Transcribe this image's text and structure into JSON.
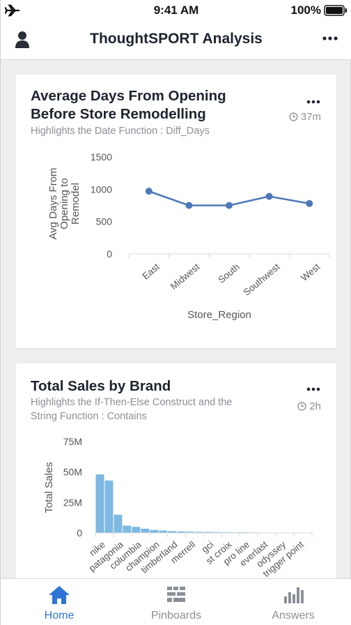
{
  "status_bar": {
    "time": "9:41 AM",
    "battery": "100%"
  },
  "app_bar": {
    "title": "ThoughtSPORT Analysis"
  },
  "cards": [
    {
      "title_line1": "Average Days From Opening",
      "title_line2": "Before Store Remodelling",
      "subtitle": "Highlights the Date Function : Diff_Days",
      "age": "37m",
      "chart_data": {
        "type": "line",
        "categories": [
          "East",
          "Midwest",
          "South",
          "Southwest",
          "West"
        ],
        "values": [
          970,
          750,
          750,
          890,
          780
        ],
        "yticks": [
          "1500",
          "1000",
          "500",
          "0"
        ],
        "ylim": [
          0,
          1500
        ],
        "xlabel": "Store_Region",
        "ylabel_lines": [
          "Avg Days From",
          "Opening to",
          "Remodel"
        ],
        "color": "#4e79b8"
      }
    },
    {
      "title_line1": "Total Sales by Brand",
      "subtitle_line1": "Highlights the If-Then-Else Construct and the",
      "subtitle_line2": "String Function : Contains",
      "age": "2h",
      "chart_data": {
        "type": "bar",
        "categories": [
          "nike",
          "",
          "patagonia",
          "",
          "columbia",
          "",
          "champion",
          "",
          "timberland",
          "",
          "merrell",
          "",
          "gci",
          "",
          "st croix",
          "",
          "pro line",
          "",
          "everlast",
          "",
          "odyssey",
          "",
          "trigger point",
          ""
        ],
        "values": [
          48,
          43,
          15,
          6,
          5,
          3.5,
          2.5,
          2,
          1.5,
          1.2,
          1,
          0.9,
          0.8,
          0.7,
          0.6,
          0.5,
          0.5,
          0.4,
          0.35,
          0.3,
          0.25,
          0.2,
          0.15,
          0.1
        ],
        "yticks": [
          "75M",
          "50M",
          "25M",
          "0"
        ],
        "ylim": [
          0,
          75
        ],
        "ylabel": "Total Sales",
        "color": "#7db9e2"
      }
    }
  ],
  "tabs": [
    {
      "label": "Home",
      "icon": "home-icon"
    },
    {
      "label": "Pinboards",
      "icon": "pinboards-icon"
    },
    {
      "label": "Answers",
      "icon": "answers-icon"
    }
  ],
  "colors": {
    "accent": "#2e75d5",
    "muted": "#8b8f98"
  }
}
